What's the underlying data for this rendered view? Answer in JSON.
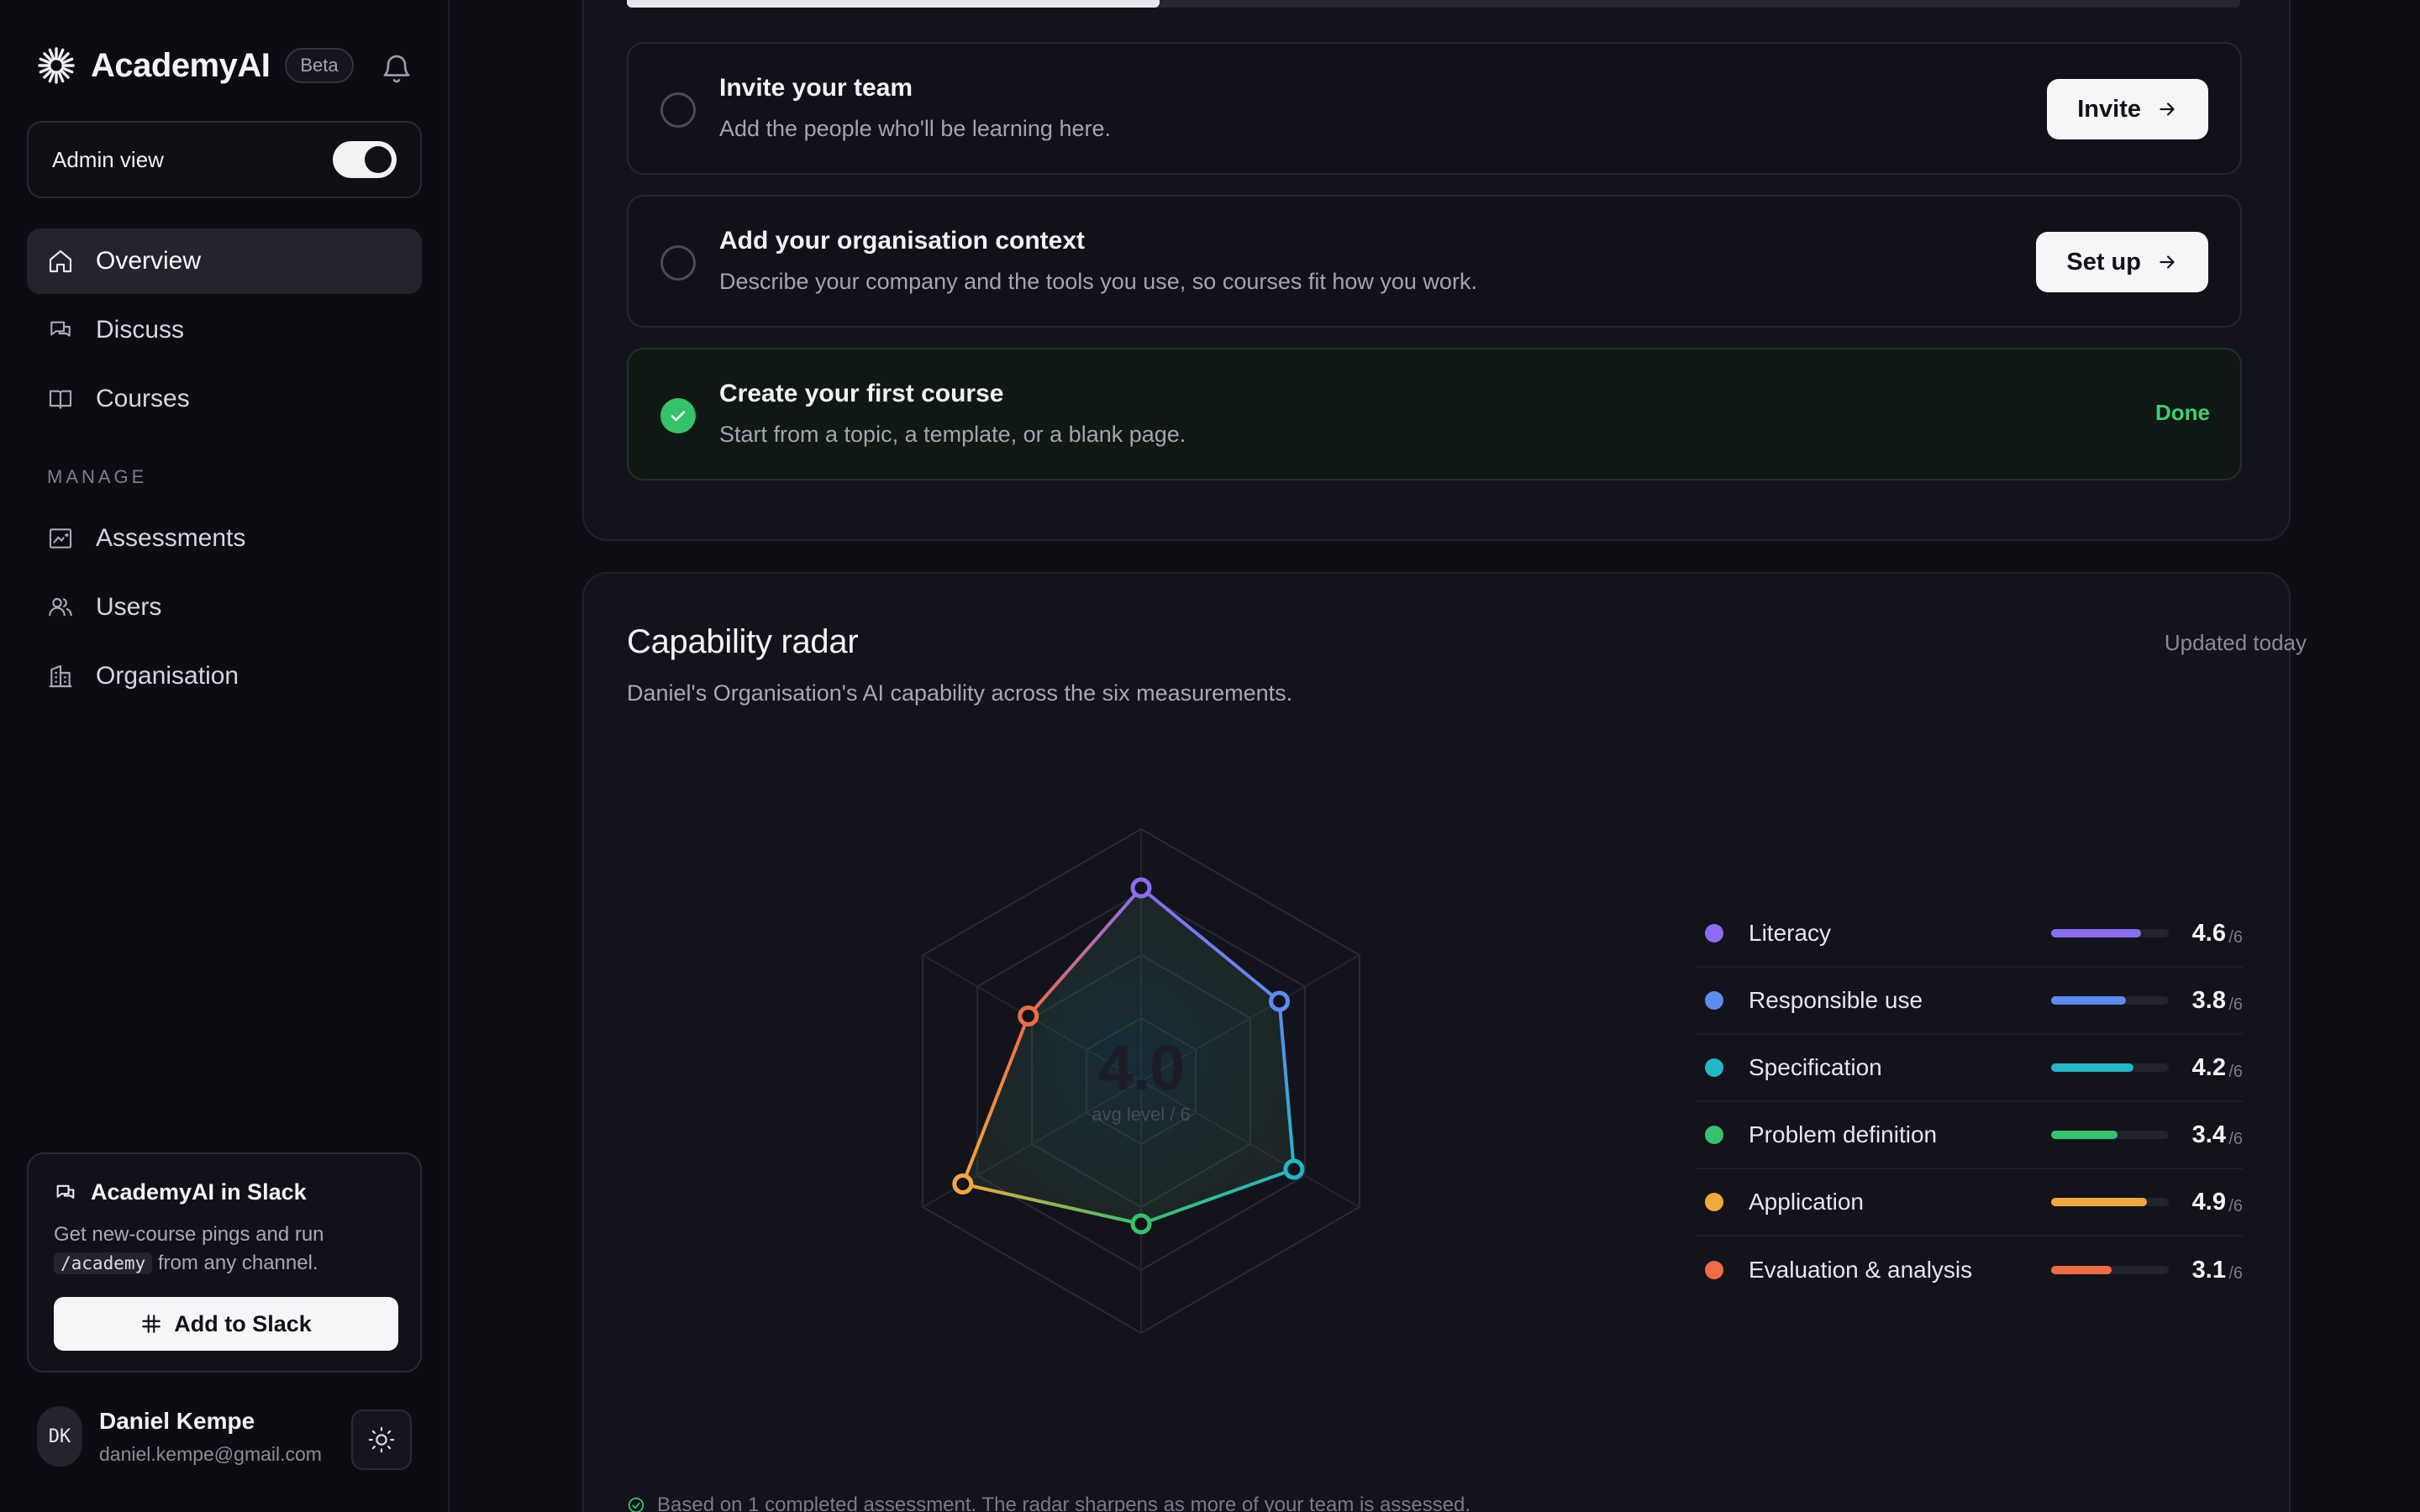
{
  "brand": {
    "name": "AcademyAI",
    "badge": "Beta"
  },
  "admin": {
    "label": "Admin view",
    "enabled": true
  },
  "nav": {
    "primary": [
      {
        "label": "Overview",
        "icon": "home-icon",
        "active": true
      },
      {
        "label": "Discuss",
        "icon": "chat-icon",
        "active": false
      },
      {
        "label": "Courses",
        "icon": "book-icon",
        "active": false
      }
    ],
    "section_label": "MANAGE",
    "manage": [
      {
        "label": "Assessments",
        "icon": "chart-icon"
      },
      {
        "label": "Users",
        "icon": "users-icon"
      },
      {
        "label": "Organisation",
        "icon": "building-icon"
      }
    ]
  },
  "slack": {
    "title": "AcademyAI in Slack",
    "desc_before": "Get new-course pings and run",
    "command": "/academy",
    "desc_after": "from any channel.",
    "button": "Add to Slack"
  },
  "user": {
    "initials": "DK",
    "name": "Daniel Kempe",
    "email": "daniel.kempe@gmail.com"
  },
  "onboarding": {
    "progress": 0.33,
    "steps": [
      {
        "title": "Invite your team",
        "desc": "Add the people who'll be learning here.",
        "action": "Invite",
        "done": false
      },
      {
        "title": "Add your organisation context",
        "desc": "Describe your company and the tools you use, so courses fit how you work.",
        "action": "Set up",
        "done": false
      },
      {
        "title": "Create your first course",
        "desc": "Start from a topic, a template, or a blank page.",
        "action": "Done",
        "done": true
      }
    ]
  },
  "radar": {
    "title": "Capability radar",
    "updated": "Updated today",
    "subtitle": "Daniel's Organisation's AI capability across the six measurements.",
    "avg": "4.0",
    "avg_label": "avg level / 6",
    "max": 6,
    "max_label": "/6",
    "note": "Based on 1 completed assessment. The radar sharpens as more of your team is assessed.",
    "colors": {
      "literacy": "#8b6cf2",
      "responsible": "#5b8cf0",
      "specification": "#22b7c7",
      "problem": "#35c26b",
      "application": "#f2a93b",
      "evaluation": "#ef6d45"
    }
  },
  "chart_data": {
    "type": "radar",
    "max": 6,
    "categories": [
      "Literacy",
      "Responsible use",
      "Specification",
      "Problem definition",
      "Application",
      "Evaluation & analysis"
    ],
    "values": [
      4.6,
      3.8,
      4.2,
      3.4,
      4.9,
      3.1
    ],
    "value_labels": [
      "4.6",
      "3.8",
      "4.2",
      "3.4",
      "4.9",
      "3.1"
    ],
    "colors": [
      "#8b6cf2",
      "#5b8cf0",
      "#22b7c7",
      "#35c26b",
      "#f2a93b",
      "#ef6d45"
    ]
  }
}
